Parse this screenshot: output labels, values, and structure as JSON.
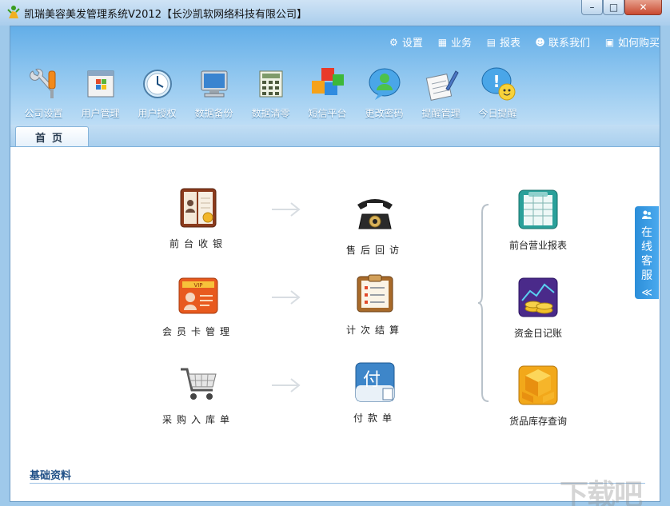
{
  "window": {
    "title": "凯瑞美容美发管理系统V2012【长沙凯软网络科技有限公司】",
    "minimize": "–",
    "maximize": "□",
    "close": "✕"
  },
  "topmenu": [
    {
      "label": "设置",
      "icon": "gear-icon"
    },
    {
      "label": "业务",
      "icon": "business-icon"
    },
    {
      "label": "报表",
      "icon": "report-icon"
    },
    {
      "label": "联系我们",
      "icon": "contact-icon"
    },
    {
      "label": "如何购买",
      "icon": "purchase-icon"
    }
  ],
  "toolbar": [
    {
      "label": "公司设置",
      "icon": "tools-icon"
    },
    {
      "label": "用户管理",
      "icon": "user-window-icon"
    },
    {
      "label": "用户授权",
      "icon": "clock-globe-icon"
    },
    {
      "label": "数据备份",
      "icon": "computer-icon"
    },
    {
      "label": "数据清零",
      "icon": "calculator-icon"
    },
    {
      "label": "短信平台",
      "icon": "cubes-icon"
    },
    {
      "label": "更改密码",
      "icon": "user-bubble-icon"
    },
    {
      "label": "提醒管理",
      "icon": "notepad-pen-icon"
    },
    {
      "label": "今日提醒",
      "icon": "smiley-bubble-icon"
    }
  ],
  "tab": {
    "label": "首页"
  },
  "functions": {
    "frontdesk": "前台收银",
    "aftersales": "售后回访",
    "member_card": "会员卡管理",
    "count_settle": "计次结算",
    "purchase": "采购入库单",
    "payment": "付款单",
    "daily_report": "前台营业报表",
    "cash_journal": "资金日记账",
    "inventory": "货品库存查询",
    "payment_icon_char": "付"
  },
  "basic_section": "基础资料",
  "online_service": {
    "chars": [
      "在",
      "线",
      "客",
      "服"
    ],
    "chevron": "≪"
  },
  "watermark": "下载吧"
}
